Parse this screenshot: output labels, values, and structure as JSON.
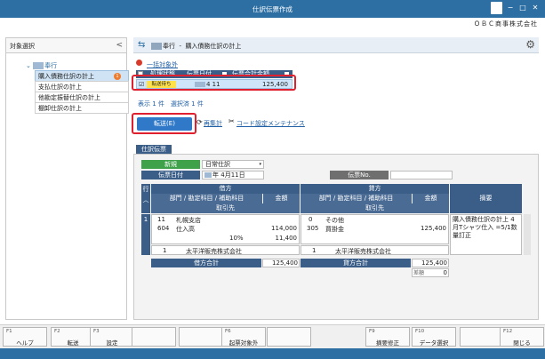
{
  "window": {
    "title": "仕訳伝票作成",
    "company": "ＯＢＣ商事株式会社"
  },
  "left": {
    "header": "対象選択",
    "collapse_glyph": "<",
    "root_label": "奉行",
    "items": [
      {
        "label": "購入債務仕訳の計上",
        "badge": "1"
      },
      {
        "label": "支払仕訳の計上"
      },
      {
        "label": "他勘定振替仕訳の計上"
      },
      {
        "label": "棚卸仕訳の計上"
      }
    ]
  },
  "main": {
    "breadcrumb_app": "奉行",
    "breadcrumb_sep": "-",
    "breadcrumb_title": "購入債務仕訳の計上",
    "bulk_exclude_link": "一括対象外",
    "list_headers": [
      "処理状態",
      "伝票日付",
      "伝票合計金額"
    ],
    "list_row": {
      "status": "転送待ち",
      "date": "4  11",
      "amount": "125,400"
    },
    "summary": "表示 1 件　選択済 1 件",
    "transfer_button": "転送(E)",
    "recalc_link": "再集計",
    "code_link": "コード設定メンテナンス"
  },
  "voucher": {
    "tab": "仕訳伝票",
    "new_label": "新規",
    "type_value": "日常仕訳",
    "date_label": "伝票日付",
    "date_year": "年",
    "date_value": "4月11日",
    "no_label": "伝票No.",
    "row_header": "行",
    "debit_header": "借方",
    "credit_header": "貸方",
    "sub_header": "部門 / 勘定科目 / 補助科目",
    "amount_header": "金額",
    "partner_header": "取引先",
    "desc_header": "摘要",
    "line_no": "1",
    "debit": {
      "dept_code": "11",
      "dept_name": "札幌支店",
      "acct_code": "604",
      "acct_name": "仕入高",
      "amount": "114,000",
      "tax_rate": "10%",
      "tax_amount": "11,400",
      "partner_code": "1",
      "partner_name": "太平洋販売株式会社"
    },
    "credit": {
      "dept_code": "0",
      "dept_name": "その他",
      "acct_code": "305",
      "acct_name": "買掛金",
      "amount": "125,400",
      "partner_code": "1",
      "partner_name": "太平洋販売株式会社"
    },
    "description": "購入債務仕訳の計上 4月Tシャツ仕入 =5/1数量訂正",
    "debit_total_label": "借方合計",
    "debit_total": "125,400",
    "credit_total_label": "貸方合計",
    "credit_total": "125,400",
    "diff_label": "差額",
    "diff": "0"
  },
  "fkeys": [
    {
      "key": "F1",
      "label": "ヘルプ"
    },
    {
      "key": "F2",
      "label": "転送"
    },
    {
      "key": "F3",
      "label": "設定"
    },
    {
      "key": "",
      "label": ""
    },
    {
      "key": "",
      "label": ""
    },
    {
      "key": "F6",
      "label": "起票対象外"
    },
    {
      "key": "",
      "label": ""
    },
    {
      "key": "F9",
      "label": "摘要修正"
    },
    {
      "key": "F10",
      "label": "データ選択"
    },
    {
      "key": "",
      "label": ""
    },
    {
      "key": "F12",
      "label": "閉じる"
    }
  ]
}
